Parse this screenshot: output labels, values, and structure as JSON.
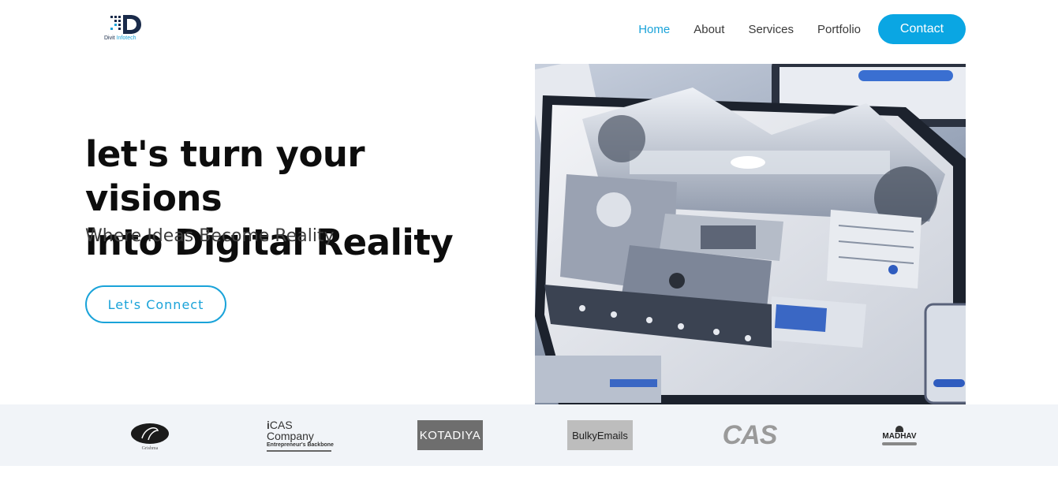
{
  "brand": {
    "name": "Divit",
    "name_accent": "Infotech"
  },
  "nav": {
    "items": [
      {
        "label": "Home",
        "active": true
      },
      {
        "label": "About",
        "active": false
      },
      {
        "label": "Services",
        "active": false
      },
      {
        "label": "Portfolio",
        "active": false
      }
    ],
    "contact_label": "Contact"
  },
  "hero": {
    "title_line1": "let's turn your visions",
    "title_line2": "into Digital Reality",
    "subtitle": "Where Ideas Become Reality",
    "cta_label": "Let's Connect"
  },
  "clients": {
    "logos": [
      {
        "name": "Grishma",
        "text": "Grishma"
      },
      {
        "name": "iCAS Company",
        "text": "CAS Company",
        "tagline": "Entrepreneur's Backbone"
      },
      {
        "name": "Kotadiya",
        "text": "KOTADIYA"
      },
      {
        "name": "BulkyEmails",
        "text": "BulkyEmails"
      },
      {
        "name": "CAS",
        "text": "CAS"
      },
      {
        "name": "Madhav",
        "text": "MADHAV"
      }
    ]
  },
  "colors": {
    "accent": "#0aa6e3",
    "text_dark": "#0d0d0d",
    "strip_bg": "#f1f4f8"
  },
  "icons": [
    "divit-logo-icon"
  ]
}
